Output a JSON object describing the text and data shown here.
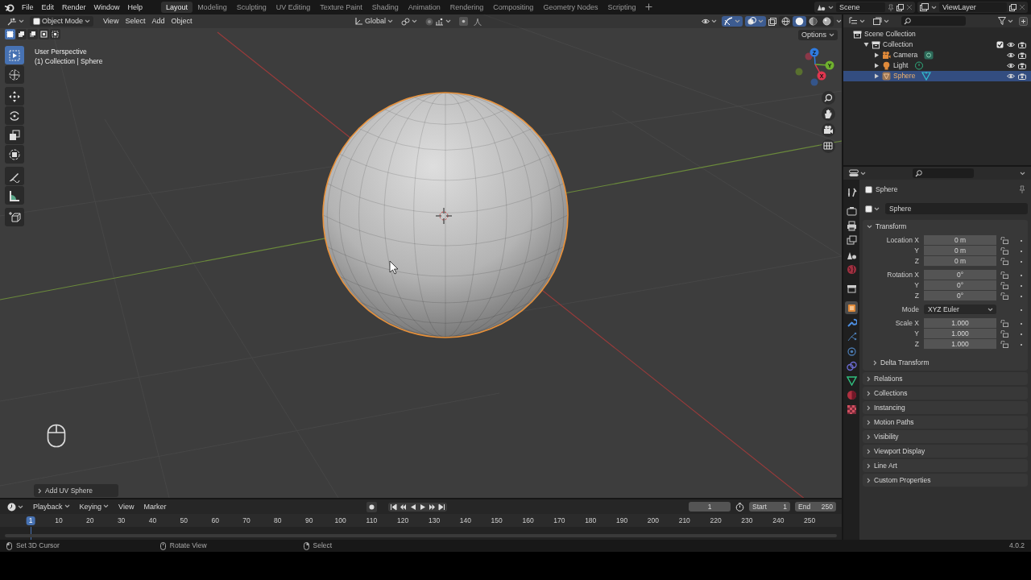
{
  "top_bar": {
    "menus": [
      "File",
      "Edit",
      "Render",
      "Window",
      "Help"
    ],
    "workspaces": [
      {
        "label": "Layout",
        "selected": true
      },
      {
        "label": "Modeling",
        "selected": false
      },
      {
        "label": "Sculpting",
        "selected": false
      },
      {
        "label": "UV Editing",
        "selected": false
      },
      {
        "label": "Texture Paint",
        "selected": false
      },
      {
        "label": "Shading",
        "selected": false
      },
      {
        "label": "Animation",
        "selected": false
      },
      {
        "label": "Rendering",
        "selected": false
      },
      {
        "label": "Compositing",
        "selected": false
      },
      {
        "label": "Geometry Nodes",
        "selected": false
      },
      {
        "label": "Scripting",
        "selected": false
      }
    ],
    "scene": "Scene",
    "view_layer": "ViewLayer"
  },
  "viewport": {
    "mode": "Object Mode",
    "menus": [
      "View",
      "Select",
      "Add",
      "Object"
    ],
    "orientation": "Global",
    "options": "Options",
    "selection_modes": [
      {
        "selected": true
      },
      {
        "selected": false
      },
      {
        "selected": false
      },
      {
        "selected": false
      },
      {
        "selected": false
      }
    ],
    "shading": [
      {
        "kind": "wireframe",
        "selected": false
      },
      {
        "kind": "solid",
        "selected": true
      },
      {
        "kind": "material",
        "selected": false
      },
      {
        "kind": "rendered",
        "selected": false
      }
    ],
    "tools": [
      {
        "kind": "select",
        "selected": true
      },
      {
        "kind": "cursor",
        "selected": false
      },
      {
        "kind": "move",
        "selected": false
      },
      {
        "kind": "rotate",
        "selected": false
      },
      {
        "kind": "scale",
        "selected": false
      },
      {
        "kind": "transform",
        "selected": false
      },
      {
        "kind": "annotate",
        "selected": false
      },
      {
        "kind": "measure",
        "selected": false
      },
      {
        "kind": "add_cube",
        "selected": false
      }
    ],
    "info": [
      "User Perspective",
      "(1) Collection | Sphere"
    ],
    "gizmo_axes": [
      {
        "label": "Z",
        "color": "#2f7be0"
      },
      {
        "label": "Y",
        "color": "#6fb12e"
      },
      {
        "label": "X",
        "color": "#e0364f"
      }
    ],
    "last_operator": "Add UV Sphere"
  },
  "outliner": {
    "items": [
      {
        "label": "Scene Collection",
        "kind": "scene_collection",
        "selected": false,
        "children": [
          {
            "label": "Collection",
            "kind": "collection",
            "selected": false,
            "expanded": true,
            "checked": true,
            "children": [
              {
                "label": "Camera",
                "kind": "camera",
                "selected": false,
                "expanded": false
              },
              {
                "label": "Light",
                "kind": "light",
                "selected": false,
                "expanded": false
              },
              {
                "label": "Sphere",
                "kind": "mesh",
                "selected": true,
                "expanded": false
              }
            ]
          }
        ]
      }
    ]
  },
  "properties": {
    "tabs": [
      {
        "kind": "tool",
        "selected": false
      },
      {
        "kind": "render",
        "selected": false
      },
      {
        "kind": "output",
        "selected": false
      },
      {
        "kind": "view_layer",
        "selected": false
      },
      {
        "kind": "scene",
        "selected": false
      },
      {
        "kind": "world",
        "selected": false
      },
      {
        "kind": "collection",
        "selected": false
      },
      {
        "kind": "object",
        "selected": true
      },
      {
        "kind": "modifier",
        "selected": false
      },
      {
        "kind": "particles",
        "selected": false
      },
      {
        "kind": "physics",
        "selected": false
      },
      {
        "kind": "constraints",
        "selected": false
      },
      {
        "kind": "data",
        "selected": false
      },
      {
        "kind": "material",
        "selected": false
      },
      {
        "kind": "texture",
        "selected": false
      }
    ],
    "object": "Sphere",
    "data": "Sphere",
    "transform": {
      "title": "Transform",
      "expanded": true,
      "groups": [
        {
          "rows": [
            {
              "label": "Location X",
              "value": "0 m",
              "kind": "number"
            },
            {
              "label": "Y",
              "value": "0 m",
              "kind": "number"
            },
            {
              "label": "Z",
              "value": "0 m",
              "kind": "number"
            }
          ]
        },
        {
          "rows": [
            {
              "label": "Rotation X",
              "value": "0°",
              "kind": "number"
            },
            {
              "label": "Y",
              "value": "0°",
              "kind": "number"
            },
            {
              "label": "Z",
              "value": "0°",
              "kind": "number"
            }
          ]
        },
        {
          "rows": [
            {
              "label": "Mode",
              "value": "XYZ Euler",
              "kind": "dropdown"
            }
          ]
        },
        {
          "rows": [
            {
              "label": "Scale X",
              "value": "1.000",
              "kind": "number"
            },
            {
              "label": "Y",
              "value": "1.000",
              "kind": "number"
            },
            {
              "label": "Z",
              "value": "1.000",
              "kind": "number"
            }
          ]
        }
      ],
      "subpanel": {
        "label": "Delta Transform",
        "expanded": false
      }
    },
    "panels": [
      {
        "label": "Relations",
        "expanded": false
      },
      {
        "label": "Collections",
        "expanded": false
      },
      {
        "label": "Instancing",
        "expanded": false
      },
      {
        "label": "Motion Paths",
        "expanded": false
      },
      {
        "label": "Visibility",
        "expanded": false
      },
      {
        "label": "Viewport Display",
        "expanded": false
      },
      {
        "label": "Line Art",
        "expanded": false
      },
      {
        "label": "Custom Properties",
        "expanded": false
      }
    ]
  },
  "timeline": {
    "menus": [
      {
        "label": "Playback",
        "kind": "dropdown"
      },
      {
        "label": "Keying",
        "kind": "dropdown"
      },
      {
        "label": "View",
        "kind": "plain"
      },
      {
        "label": "Marker",
        "kind": "plain"
      }
    ],
    "current_frame": "1",
    "start_label": "Start",
    "start": "1",
    "end_label": "End",
    "end": "250",
    "ruler": [
      {
        "label": "1",
        "selected": true
      },
      {
        "label": "10",
        "selected": false
      },
      {
        "label": "20",
        "selected": false
      },
      {
        "label": "30",
        "selected": false
      },
      {
        "label": "40",
        "selected": false
      },
      {
        "label": "50",
        "selected": false
      },
      {
        "label": "60",
        "selected": false
      },
      {
        "label": "70",
        "selected": false
      },
      {
        "label": "80",
        "selected": false
      },
      {
        "label": "90",
        "selected": false
      },
      {
        "label": "100",
        "selected": false
      },
      {
        "label": "110",
        "selected": false
      },
      {
        "label": "120",
        "selected": false
      },
      {
        "label": "130",
        "selected": false
      },
      {
        "label": "140",
        "selected": false
      },
      {
        "label": "150",
        "selected": false
      },
      {
        "label": "160",
        "selected": false
      },
      {
        "label": "170",
        "selected": false
      },
      {
        "label": "180",
        "selected": false
      },
      {
        "label": "190",
        "selected": false
      },
      {
        "label": "200",
        "selected": false
      },
      {
        "label": "210",
        "selected": false
      },
      {
        "label": "220",
        "selected": false
      },
      {
        "label": "230",
        "selected": false
      },
      {
        "label": "240",
        "selected": false
      },
      {
        "label": "250",
        "selected": false
      }
    ]
  },
  "status_bar": {
    "hints": [
      "Set 3D Cursor",
      "Rotate View",
      "Select"
    ],
    "version": "4.0.2"
  }
}
